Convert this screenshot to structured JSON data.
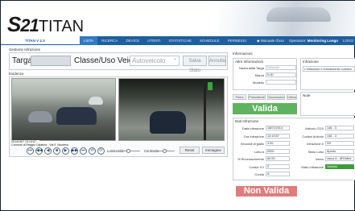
{
  "app": {
    "logo_prefix": "S",
    "logo_number": "21",
    "logo_name": "TITAN",
    "version": "TITAN V 2.3"
  },
  "nav": {
    "items": [
      "LISTA",
      "RICERCA",
      "DEVICE",
      "UTENTI",
      "STATISTICHE",
      "SCHEDULE",
      "PERMESSI"
    ],
    "active_index": 0,
    "manual_label": "Manuale d'uso",
    "operator_label": "Operatore:",
    "operator_name": "Monitoring Longo",
    "logout_label": "LOGO"
  },
  "gestione": {
    "section_label": "Gestione Infrazione",
    "targa_label": "Targa",
    "classe_label": "Classe/Uso Veicolo",
    "classe_value": "Autoveicolo",
    "salva_button": "Salva Stato",
    "annulla_button": "Annulla"
  },
  "evidenze": {
    "section_label": "Evidenze",
    "caption_line1": "2014/18/7 13:13:57 ...",
    "caption_line2": "Comune di Reggio Calabria - Via F. Nicotera",
    "controls": [
      "⏮",
      "◀◀",
      "◀",
      "■",
      "▶",
      "▶▶",
      "⏭",
      "⟲",
      "⟳"
    ],
    "luminosita_label": "Luminosità",
    "contrasto_label": "Contrasto",
    "luminosita_level": 0.35,
    "contrasto_level": 0.45,
    "reset_button": "Reset",
    "immagine_button": "Immagine"
  },
  "informazioni": {
    "section_label": "Informazioni",
    "altre_info_label": "Altre Informazioni",
    "infrazione_label": "Infrazione",
    "nazionalita_label": "Nazionalità Targa",
    "nazionalita_value": "Nessuno",
    "marca_label": "Marca",
    "marca_value": "N.ID",
    "modello_label": "Modello",
    "infrazione_value": "L'infrazione è formalmente corretta",
    "tabs": [
      "Prima",
      "Precedente",
      "Successiva",
      "Ultima"
    ],
    "note_label": "Note",
    "valida_label": "Valida",
    "non_valida_label": "Non Valida"
  },
  "dati": {
    "section_label": "Dati Infrazione",
    "left_fields": [
      {
        "label": "Data Infrazione",
        "value": "18/07/2014"
      },
      {
        "label": "Ora Infrazione",
        "value": "13:13:57"
      },
      {
        "label": "Secondi di giallo",
        "value": "3.00"
      },
      {
        "label": "Lotto #",
        "value": "0000"
      },
      {
        "label": "% Riconoscimento",
        "value": "80.00"
      },
      {
        "label": "Codice ICI",
        "value": "0"
      },
      {
        "label": "Corsia",
        "value": "A"
      }
    ],
    "right_fields": [
      {
        "label": "Articolo CDS",
        "value": "146 - 3"
      },
      {
        "label": "Codice Articolo",
        "value": "146 - 3"
      },
      {
        "label": "Infrazione #",
        "value": "0/0"
      },
      {
        "label": "Stato Lotto",
        "value": "Aperto"
      },
      {
        "label": "Varco",
        "value": "varco 6 - 6FDMed"
      },
      {
        "label": "Stato Infrazione",
        "value": "Validata"
      }
    ]
  }
}
